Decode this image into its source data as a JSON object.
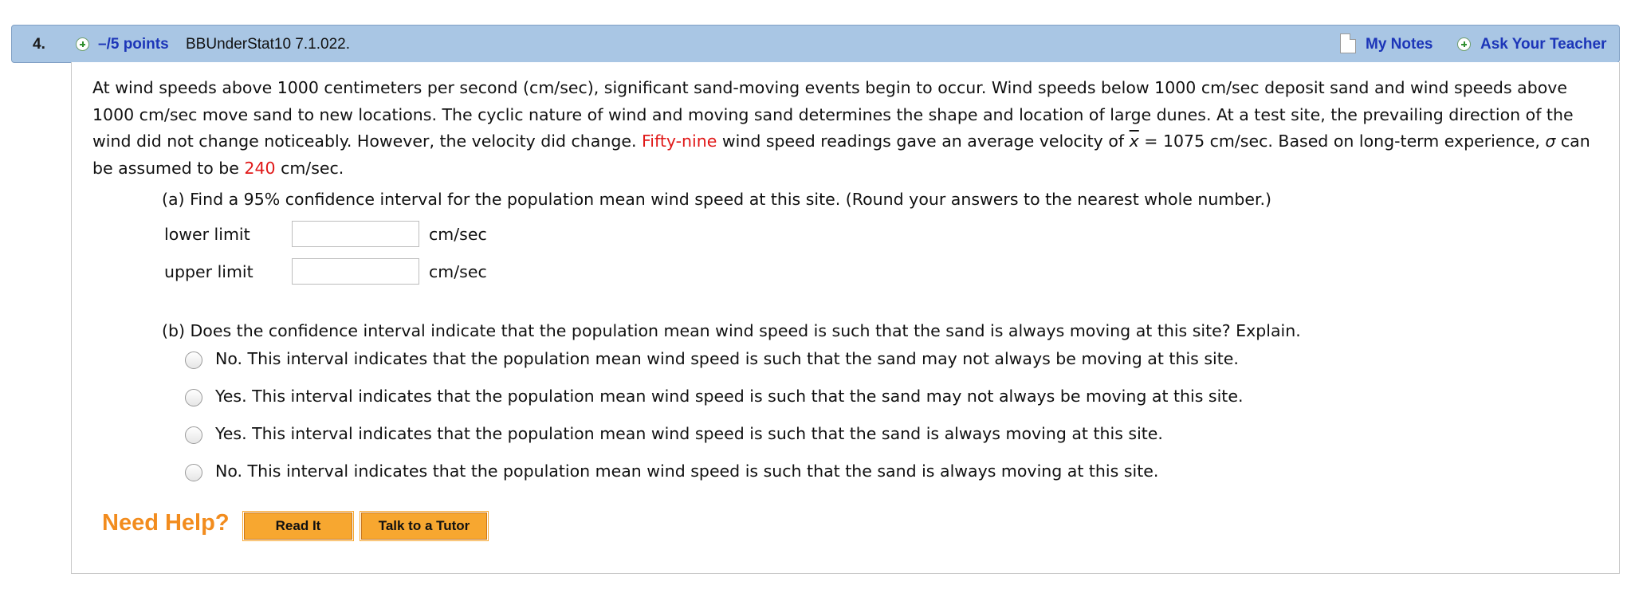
{
  "header": {
    "question_number": "4.",
    "points_label": "–/5 points",
    "source": "BBUnderStat10 7.1.022.",
    "my_notes_label": "My Notes",
    "ask_teacher_label": "Ask Your Teacher"
  },
  "problem": {
    "text_1": "At wind speeds above 1000 centimeters per second (cm/sec), significant sand-moving events begin to occur. Wind speeds below 1000 cm/sec deposit sand and wind speeds above 1000 cm/sec move sand to new locations. The cyclic nature of wind and moving sand determines the shape and location of large dunes. At a test site, the prevailing direction of the wind did not change noticeably. However, the velocity did change. ",
    "red_count": "Fifty-nine",
    "text_2": " wind speed readings gave an average velocity of ",
    "xbar_symbol": "x",
    "text_3": " = 1075 cm/sec. Based on long-term experience, ",
    "sigma_symbol": "σ",
    "text_4": " can be assumed to be ",
    "red_sigma": "240",
    "text_5": " cm/sec."
  },
  "part_a": {
    "label": "(a) Find a 95% confidence interval for the population mean wind speed at this site. (Round your answers to the nearest whole number.)",
    "lower_label": "lower limit",
    "lower_value": "",
    "upper_label": "upper limit",
    "upper_value": "",
    "unit": "cm/sec"
  },
  "part_b": {
    "label": "(b) Does the confidence interval indicate that the population mean wind speed is such that the sand is always moving at this site? Explain.",
    "options": [
      "No. This interval indicates that the population mean wind speed is such that the sand may not always be moving at this site.",
      "Yes. This interval indicates that the population mean wind speed is such that the sand may not always be moving at this site.",
      "Yes. This interval indicates that the population mean wind speed is such that the sand is always moving at this site.",
      "No. This interval indicates that the population mean wind speed is such that the sand is always moving at this site."
    ]
  },
  "help": {
    "title": "Need Help?",
    "read_it": "Read It",
    "tutor": "Talk to a Tutor"
  },
  "colors": {
    "header_bg": "#a9c6e4",
    "link": "#1c35b8",
    "highlight_red": "#e01818",
    "help_orange": "#f28c1e",
    "button_orange": "#f7a730"
  }
}
